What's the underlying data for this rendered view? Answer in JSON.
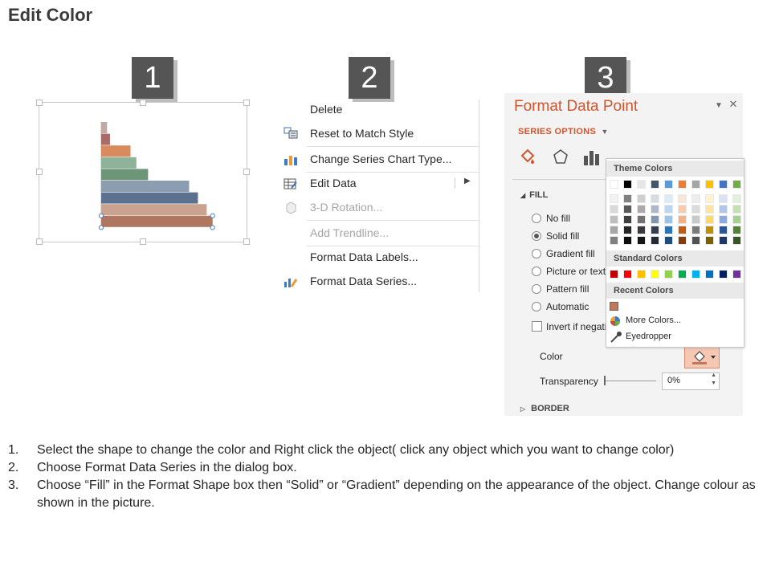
{
  "slide": {
    "title": "Edit Color"
  },
  "steps": [
    {
      "number": "1"
    },
    {
      "number": "2"
    },
    {
      "number": "3"
    }
  ],
  "chart_data": {
    "type": "bar",
    "orientation": "horizontal",
    "values": [
      2,
      3,
      10,
      12,
      16,
      30,
      33,
      36,
      38
    ],
    "colors": [
      "#c0aaa6",
      "#a96b68",
      "#d98b5e",
      "#8fb29a",
      "#6d9679",
      "#8c9db2",
      "#5c7190",
      "#c9a290",
      "#b07760"
    ],
    "axis": "vertical-left",
    "grid": false,
    "legend": "none"
  },
  "context_menu": {
    "items": [
      {
        "label": "Delete",
        "icon": "none",
        "enabled": true
      },
      {
        "label": "Reset to Match Style",
        "icon": "reset-style-icon",
        "enabled": true
      },
      {
        "label": "Change Series Chart Type...",
        "icon": "bar-chart-icon",
        "enabled": true
      },
      {
        "label": "Edit Data",
        "icon": "table-edit-icon",
        "enabled": true,
        "submenu": true
      },
      {
        "label": "3-D Rotation...",
        "icon": "cube-icon",
        "enabled": false
      },
      {
        "label": "Add Trendline...",
        "icon": "none",
        "enabled": false
      },
      {
        "label": "Format Data Labels...",
        "icon": "none",
        "enabled": true
      },
      {
        "label": "Format Data Series...",
        "icon": "format-series-icon",
        "enabled": true
      }
    ]
  },
  "format_pane": {
    "title": "Format Data Point",
    "series_options_label": "SERIES OPTIONS",
    "fill_label": "FILL",
    "border_label": "BORDER",
    "fill_options": [
      {
        "label": "No fill",
        "selected": false
      },
      {
        "label": "Solid fill",
        "selected": true
      },
      {
        "label": "Gradient fill",
        "selected": false
      },
      {
        "label": "Picture or textu",
        "selected": false
      },
      {
        "label": "Pattern fill",
        "selected": false
      },
      {
        "label": "Automatic",
        "selected": false
      }
    ],
    "invert_label": "Invert if negati",
    "color_label": "Color",
    "transparency_label": "Transparency",
    "transparency_value": "0%",
    "accent_color": "#d2552c"
  },
  "color_popup": {
    "theme_colors_label": "Theme Colors",
    "standard_colors_label": "Standard Colors",
    "recent_colors_label": "Recent Colors",
    "more_colors_label": "More Colors...",
    "eyedropper_label": "Eyedropper",
    "theme_top": [
      "#ffffff",
      "#000000",
      "#e7e6e6",
      "#44546a",
      "#5b9bd5",
      "#ed7d31",
      "#a5a5a5",
      "#ffc000",
      "#4472c4",
      "#70ad47"
    ],
    "theme_shades": [
      [
        "#f2f2f2",
        "#d9d9d9",
        "#bfbfbf",
        "#a6a6a6",
        "#808080"
      ],
      [
        "#808080",
        "#595959",
        "#404040",
        "#262626",
        "#0d0d0d"
      ],
      [
        "#d0cece",
        "#aeaaaa",
        "#757171",
        "#3a3838",
        "#171616"
      ],
      [
        "#d6dce4",
        "#adb9ca",
        "#8497b0",
        "#333f4f",
        "#222a35"
      ],
      [
        "#deebf6",
        "#bdd7ee",
        "#9dc3e6",
        "#2e75b5",
        "#1e4e79"
      ],
      [
        "#fbe5d5",
        "#f7cbac",
        "#f4b183",
        "#c55a11",
        "#833c0b"
      ],
      [
        "#ededed",
        "#dbdbdb",
        "#c9c9c9",
        "#7b7b7b",
        "#525252"
      ],
      [
        "#fff2cc",
        "#fee599",
        "#ffd965",
        "#bf9000",
        "#7f6000"
      ],
      [
        "#d9e2f3",
        "#b4c6e7",
        "#8eaadb",
        "#2f5496",
        "#1f3864"
      ],
      [
        "#e2efd9",
        "#c5e0b3",
        "#a8d08d",
        "#538135",
        "#375623"
      ]
    ],
    "standard": [
      "#c00000",
      "#ff0000",
      "#ffc000",
      "#ffff00",
      "#92d050",
      "#00b050",
      "#00b0f0",
      "#0070c0",
      "#002060",
      "#7030a0"
    ],
    "recent": [
      "#c0785a"
    ]
  },
  "instructions": [
    {
      "num": "1.",
      "text": "Select the shape to change the color and Right click the object( click any object which you want to change color)"
    },
    {
      "num": "2.",
      "text": "Choose Format Data Series in the dialog box."
    },
    {
      "num": "3.",
      "text": "Choose “Fill” in the Format Shape box then “Solid” or “Gradient” depending on the appearance of the object. Change colour as shown in the picture."
    }
  ]
}
